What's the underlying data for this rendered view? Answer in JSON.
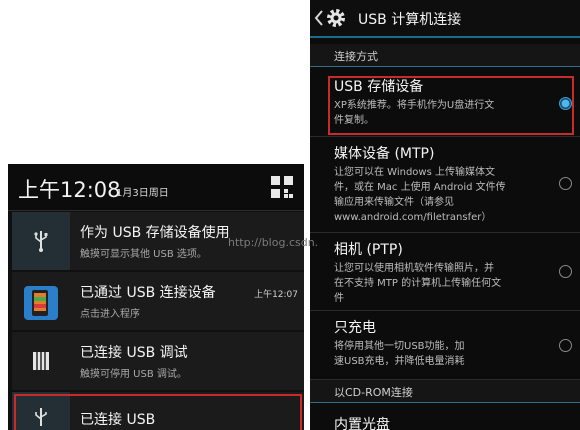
{
  "left_panel": {
    "status_time": "上午12:08",
    "status_date": "1月3日周日",
    "notifications": [
      {
        "title": "作为 USB 存储设备使用",
        "subtitle": "触摸可显示其他 USB 选项。",
        "time": "",
        "icon": "usb-icon"
      },
      {
        "title": "已通过 USB 连接设备",
        "subtitle": "点击进入程序",
        "time": "上午12:07",
        "icon": "phone-app-icon"
      },
      {
        "title": "已连接 USB 调试",
        "subtitle": "触摸可停用 USB 调试。",
        "time": "",
        "icon": "debug-icon"
      },
      {
        "title": "已连接 USB",
        "subtitle": "",
        "time": "",
        "icon": "usb-icon"
      }
    ]
  },
  "right_panel": {
    "title": "USB 计算机连接",
    "sections": {
      "connection_method": "连接方式",
      "cdrom": "以CD-ROM连接"
    },
    "options": [
      {
        "title": "USB 存储设备",
        "desc": [
          "XP系统推荐。将手机作为U盘进行文",
          "件复制。"
        ],
        "selected": true
      },
      {
        "title": "媒体设备 (MTP)",
        "desc": [
          "让您可以在 Windows 上传输媒体文",
          "件，或在 Mac 上使用 Android 文件传",
          "输应用来传输文件（请参见",
          "www.android.com/filetransfer）"
        ],
        "selected": false
      },
      {
        "title": "相机 (PTP)",
        "desc": [
          "让您可以使用相机软件传输照片，并",
          "在不支持 MTP 的计算机上传输任何文",
          "件"
        ],
        "selected": false
      },
      {
        "title": "只充电",
        "desc": [
          "将停用其他一切USB功能，加",
          "速USB充电，并降低电量消耗"
        ],
        "selected": false
      },
      {
        "title": "内置光盘",
        "desc": [],
        "selected": false
      }
    ]
  },
  "watermark": "http://blog.csdn.",
  "colors": {
    "accent": "#3a9fd6",
    "highlight": "#c92a2a",
    "background": "#0c0c0c"
  }
}
